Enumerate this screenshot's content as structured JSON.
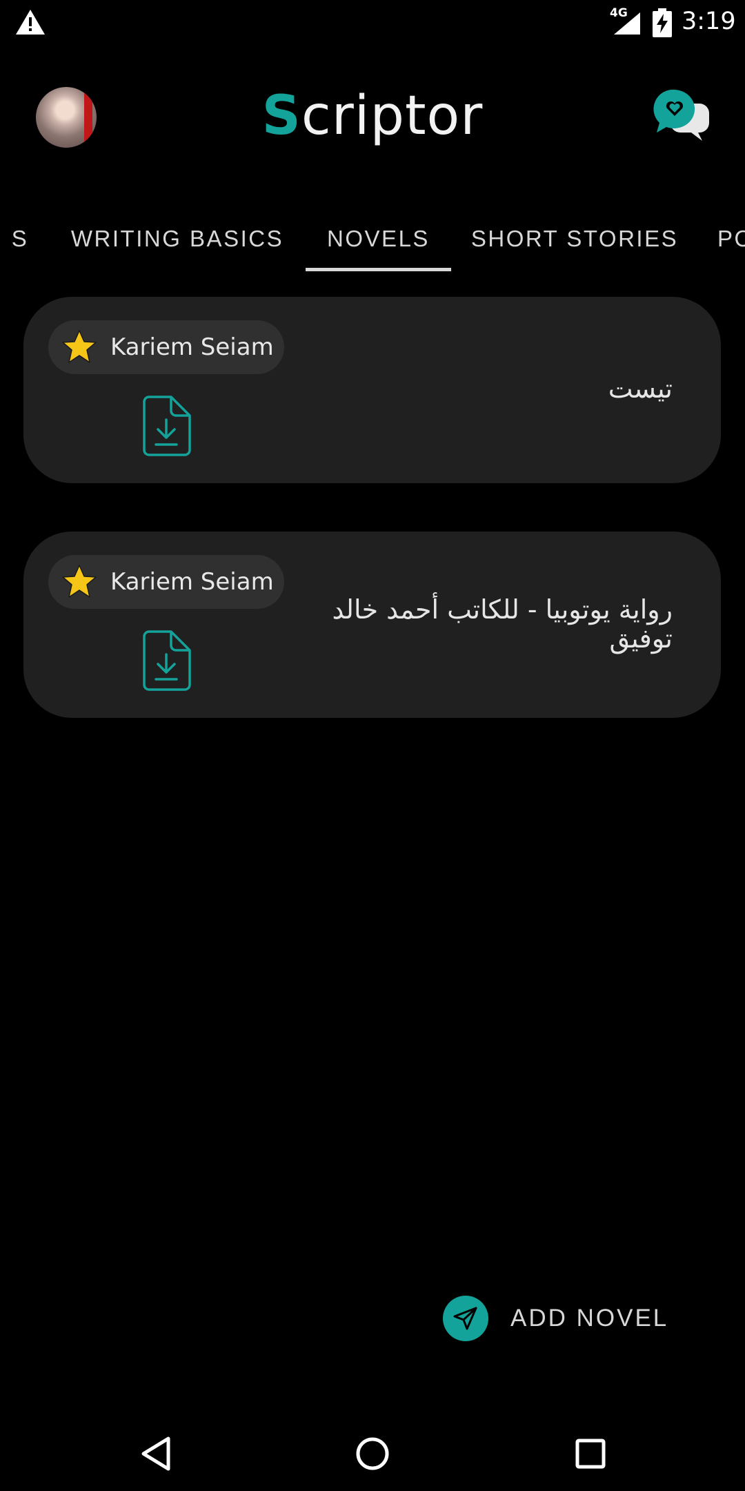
{
  "status_bar": {
    "network": "4G",
    "time": "3:19"
  },
  "header": {
    "app_title_first": "S",
    "app_title_rest": "criptor"
  },
  "tabs": [
    {
      "label": "S"
    },
    {
      "label": "WRITING BASICS"
    },
    {
      "label": "NOVELS",
      "selected": true
    },
    {
      "label": "SHORT STORIES"
    },
    {
      "label": "PO"
    }
  ],
  "cards": [
    {
      "author": "Kariem Seiam",
      "title": "تيست"
    },
    {
      "author": "Kariem Seiam",
      "title": "رواية يوتوبيا - للكاتب أحمد خالد توفيق"
    }
  ],
  "fab": {
    "label": "ADD NOVEL"
  },
  "colors": {
    "accent": "#14a39a",
    "background": "#000000",
    "card": "#202020",
    "chip": "#303030",
    "star": "#f5c518"
  }
}
